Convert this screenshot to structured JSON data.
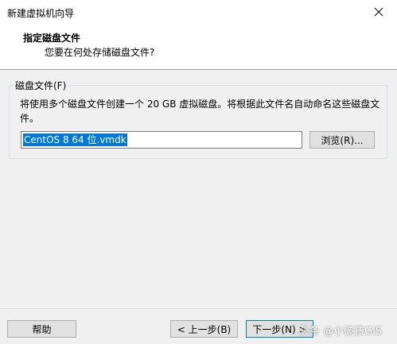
{
  "window": {
    "title": "新建虚拟机向导"
  },
  "header": {
    "title": "指定磁盘文件",
    "subtitle": "您要在何处存储磁盘文件?"
  },
  "disk_file": {
    "group_label": "磁盘文件(F)",
    "description": "将使用多个磁盘文件创建一个 20 GB 虚拟磁盘。将根据此文件名自动命名这些磁盘文件。",
    "filename": "CentOS 8 64 位.vmdk",
    "browse_label": "浏览(R)..."
  },
  "footer": {
    "help_label": "帮助",
    "back_label": "< 上一步(B)",
    "next_label": "下一步(N) >"
  },
  "watermark": {
    "text": "头条 @小破孩GIS"
  },
  "colors": {
    "selection": "#0078d7",
    "background": "#f0f0f0",
    "header_bg": "#ffffff"
  }
}
